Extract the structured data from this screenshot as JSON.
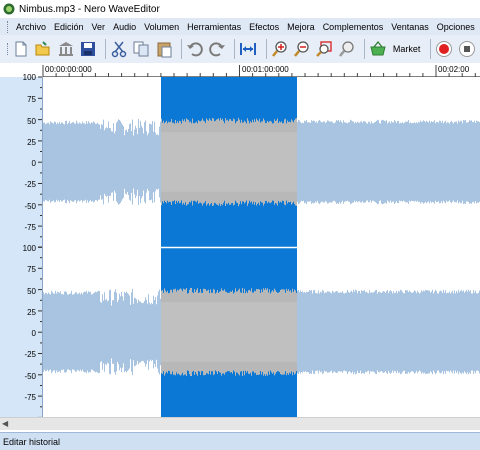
{
  "window": {
    "title": "Nimbus.mp3 - Nero WaveEditor"
  },
  "menu": {
    "items": [
      "Archivo",
      "Edición",
      "Ver",
      "Audio",
      "Volumen",
      "Herramientas",
      "Efectos",
      "Mejora",
      "Complementos",
      "Ventanas",
      "Opciones"
    ]
  },
  "toolbar": {
    "buttons": [
      "new-icon",
      "open-icon",
      "library-icon",
      "save-icon",
      "cut-icon",
      "copy-icon",
      "paste-icon",
      "undo-icon",
      "redo-icon",
      "fit-selection-icon",
      "zoom-in-icon",
      "zoom-out-icon",
      "zoom-selection-icon",
      "zoom-full-icon",
      "market-basket-icon",
      "record-icon"
    ],
    "market_label": "Market"
  },
  "timeline": {
    "labels": [
      "00:00:00:000",
      "00:01:00:000",
      "00:02:00"
    ]
  },
  "amplitude_scale": {
    "top_channel": [
      "100",
      "75",
      "50",
      "25",
      "0",
      "-25",
      "-50",
      "-75"
    ],
    "bottom_channel": [
      "100",
      "75",
      "50",
      "25",
      "0",
      "-25",
      "-50",
      "-75"
    ]
  },
  "colors": {
    "selection": "#0a78d4",
    "waveform": "#a9c4e0",
    "waveform_selected": "#b8b8b8",
    "scale_background": "#d4e6f7",
    "background": "#ffffff"
  },
  "status": {
    "text": "Editar historial"
  }
}
